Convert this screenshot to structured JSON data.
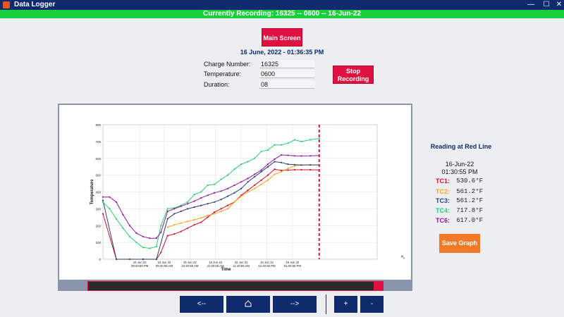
{
  "window": {
    "title": "Data Logger",
    "minimize": "—",
    "maximize": "☐",
    "close": "✕"
  },
  "recording_banner": "Currently Recording: 16325 -- 0600 -- 16-Jun-22",
  "main_screen_label": "Main Screen",
  "stop_recording_label": "Stop Recording",
  "datetime": "16 June, 2022 - 01:36:35 PM",
  "fields": {
    "charge_label": "Charge Number:",
    "charge_value": "16325",
    "temp_label": "Temperature:",
    "temp_value": "0600",
    "duration_label": "Duration:",
    "duration_value": "08"
  },
  "side": {
    "title": "Reading at Red Line",
    "date": "16-Jun-22",
    "time": "01:30:55 PM",
    "readings": [
      {
        "label": "TC1:",
        "value": "530.6°F",
        "color": "#c8102e"
      },
      {
        "label": "TC2:",
        "value": "561.2°F",
        "color": "#f5a623"
      },
      {
        "label": "TC3:",
        "value": "561.2°F",
        "color": "#2c3e7a"
      },
      {
        "label": "TC4:",
        "value": "717.8°F",
        "color": "#2ecc71"
      },
      {
        "label": "TC6:",
        "value": "617.0°F",
        "color": "#8b1a9b"
      }
    ]
  },
  "save_graph_label": "Save Graph",
  "nav": {
    "back_label": "<--",
    "home_icon": "home-icon",
    "forward_label": "-->",
    "zoom_in_label": "+",
    "zoom_out_label": "-"
  },
  "chart_data": {
    "type": "line",
    "xlabel": "Time",
    "ylabel": "Temperature",
    "ylim": [
      0,
      800
    ],
    "yticks": [
      0,
      100,
      200,
      300,
      400,
      500,
      600,
      700,
      800
    ],
    "xlim": [
      0,
      1230
    ],
    "x_ticks": [
      {
        "x": 165,
        "top": "16 Jun 22",
        "bottom": "08:03:55 PM"
      },
      {
        "x": 275,
        "top": "16 Jun 22",
        "bottom": "09:40:55 AM"
      },
      {
        "x": 390,
        "top": "16 Jun 22",
        "bottom": "10:20:55 AM"
      },
      {
        "x": 505,
        "top": "16 Jun 22",
        "bottom": "11:00:55 AM"
      },
      {
        "x": 620,
        "top": "16 Jun 22",
        "bottom": "11:40:55 AM"
      },
      {
        "x": 735,
        "top": "16 Jun 22",
        "bottom": "12:20:55 PM"
      },
      {
        "x": 850,
        "top": "16 Jun 22",
        "bottom": "01:00:55 PM"
      }
    ],
    "red_line_x": 970,
    "grid": true,
    "series": [
      {
        "name": "TC1",
        "color": "#c8102e",
        "points": [
          [
            0,
            270
          ],
          [
            60,
            0
          ],
          [
            120,
            0
          ],
          [
            180,
            0
          ],
          [
            240,
            0
          ],
          [
            260,
            40
          ],
          [
            290,
            140
          ],
          [
            320,
            150
          ],
          [
            350,
            165
          ],
          [
            380,
            185
          ],
          [
            410,
            205
          ],
          [
            440,
            220
          ],
          [
            470,
            250
          ],
          [
            500,
            280
          ],
          [
            530,
            300
          ],
          [
            560,
            320
          ],
          [
            590,
            340
          ],
          [
            620,
            380
          ],
          [
            650,
            410
          ],
          [
            680,
            440
          ],
          [
            710,
            470
          ],
          [
            740,
            500
          ],
          [
            770,
            535
          ],
          [
            800,
            528
          ],
          [
            830,
            530
          ],
          [
            860,
            532
          ],
          [
            890,
            532
          ],
          [
            930,
            532
          ],
          [
            970,
            531
          ]
        ]
      },
      {
        "name": "TC2",
        "color": "#f5a623",
        "points": [
          [
            290,
            190
          ],
          [
            320,
            205
          ],
          [
            350,
            215
          ],
          [
            380,
            225
          ],
          [
            410,
            235
          ],
          [
            440,
            245
          ],
          [
            470,
            260
          ],
          [
            500,
            270
          ],
          [
            530,
            285
          ],
          [
            560,
            300
          ],
          [
            590,
            340
          ],
          [
            620,
            375
          ],
          [
            650,
            400
          ],
          [
            680,
            420
          ],
          [
            710,
            445
          ],
          [
            740,
            470
          ],
          [
            770,
            505
          ],
          [
            800,
            520
          ],
          [
            830,
            540
          ],
          [
            860,
            555
          ],
          [
            890,
            560
          ],
          [
            930,
            561
          ],
          [
            970,
            561
          ]
        ]
      },
      {
        "name": "TC3",
        "color": "#2c3e7a",
        "points": [
          [
            0,
            350
          ],
          [
            60,
            0
          ],
          [
            120,
            0
          ],
          [
            180,
            0
          ],
          [
            240,
            0
          ],
          [
            290,
            240
          ],
          [
            320,
            270
          ],
          [
            350,
            285
          ],
          [
            380,
            300
          ],
          [
            410,
            310
          ],
          [
            440,
            320
          ],
          [
            470,
            330
          ],
          [
            500,
            340
          ],
          [
            530,
            355
          ],
          [
            560,
            375
          ],
          [
            590,
            395
          ],
          [
            620,
            420
          ],
          [
            650,
            460
          ],
          [
            680,
            490
          ],
          [
            710,
            520
          ],
          [
            740,
            550
          ],
          [
            770,
            580
          ],
          [
            800,
            575
          ],
          [
            830,
            565
          ],
          [
            860,
            562
          ],
          [
            890,
            560
          ],
          [
            930,
            561
          ],
          [
            970,
            561
          ]
        ]
      },
      {
        "name": "TC4",
        "color": "#2ecc71",
        "points": [
          [
            0,
            340
          ],
          [
            30,
            300
          ],
          [
            60,
            240
          ],
          [
            90,
            185
          ],
          [
            120,
            135
          ],
          [
            150,
            100
          ],
          [
            180,
            70
          ],
          [
            210,
            65
          ],
          [
            240,
            75
          ],
          [
            260,
            200
          ],
          [
            290,
            300
          ],
          [
            320,
            305
          ],
          [
            350,
            320
          ],
          [
            380,
            340
          ],
          [
            410,
            385
          ],
          [
            440,
            400
          ],
          [
            470,
            440
          ],
          [
            500,
            445
          ],
          [
            530,
            475
          ],
          [
            560,
            500
          ],
          [
            590,
            535
          ],
          [
            620,
            565
          ],
          [
            650,
            580
          ],
          [
            680,
            600
          ],
          [
            710,
            640
          ],
          [
            740,
            650
          ],
          [
            770,
            680
          ],
          [
            800,
            680
          ],
          [
            830,
            690
          ],
          [
            860,
            710
          ],
          [
            890,
            700
          ],
          [
            930,
            710
          ],
          [
            970,
            718
          ]
        ]
      },
      {
        "name": "TC6",
        "color": "#8b1a9b",
        "points": [
          [
            0,
            370
          ],
          [
            30,
            370
          ],
          [
            60,
            340
          ],
          [
            90,
            265
          ],
          [
            120,
            200
          ],
          [
            150,
            155
          ],
          [
            180,
            135
          ],
          [
            210,
            125
          ],
          [
            240,
            125
          ],
          [
            260,
            160
          ],
          [
            290,
            285
          ],
          [
            320,
            300
          ],
          [
            350,
            315
          ],
          [
            380,
            330
          ],
          [
            410,
            345
          ],
          [
            440,
            365
          ],
          [
            470,
            380
          ],
          [
            500,
            395
          ],
          [
            530,
            405
          ],
          [
            560,
            420
          ],
          [
            590,
            440
          ],
          [
            620,
            460
          ],
          [
            650,
            480
          ],
          [
            680,
            505
          ],
          [
            710,
            530
          ],
          [
            740,
            565
          ],
          [
            770,
            595
          ],
          [
            800,
            620
          ],
          [
            830,
            618
          ],
          [
            860,
            615
          ],
          [
            890,
            614
          ],
          [
            930,
            615
          ],
          [
            970,
            617
          ]
        ]
      }
    ]
  }
}
